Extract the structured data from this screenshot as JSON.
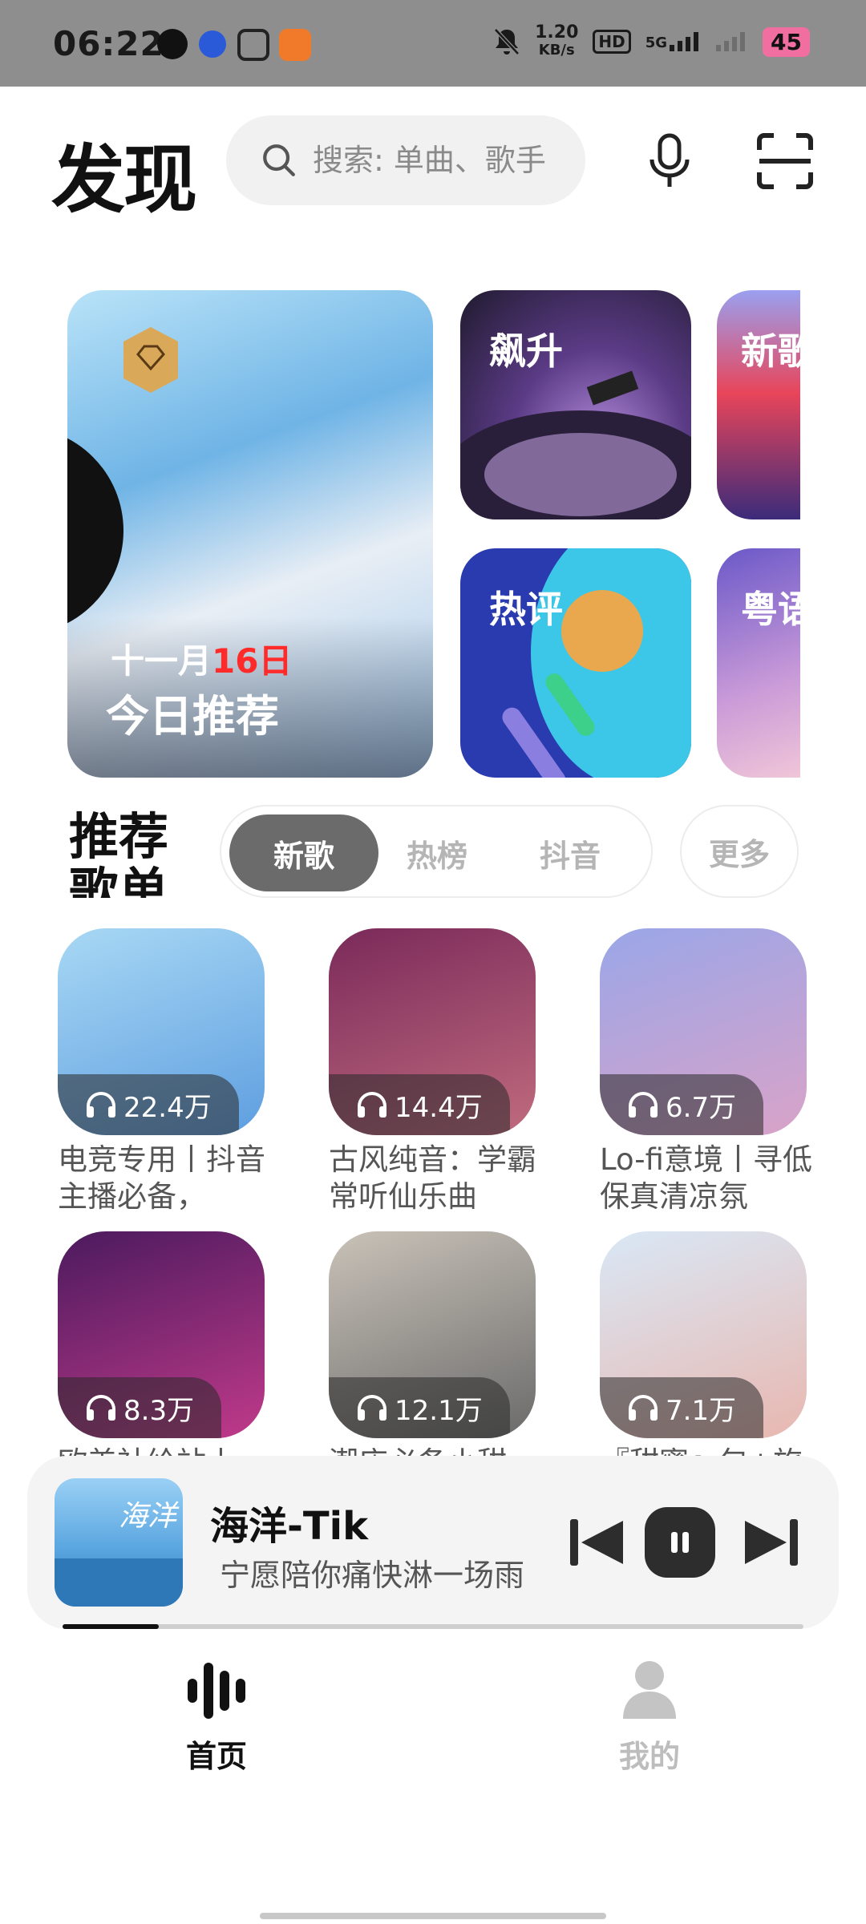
{
  "status_bar": {
    "time": "06:22",
    "net_speed_value": "1.20",
    "net_speed_unit": "KB/s",
    "hd_label": "HD",
    "network": "5G",
    "battery": "45"
  },
  "header": {
    "title": "发现",
    "search_placeholder": "搜索: 单曲、歌手"
  },
  "banners": {
    "daily": {
      "date_prefix": "十一月",
      "date_day": "16日",
      "title": "今日推荐"
    },
    "surge": "飙升",
    "hot_comments": "热评",
    "new_songs": "新歌",
    "cantonese": "粤语"
  },
  "section": {
    "title": "推荐歌单",
    "tabs": [
      "新歌",
      "热榜",
      "抖音"
    ],
    "more": "更多"
  },
  "playlists": [
    {
      "count": "22.4万",
      "title": "电竞专用丨抖音主播必备，",
      "cover": [
        "#a8d8f4",
        "#5e9ee0"
      ]
    },
    {
      "count": "14.4万",
      "title": "古风纯音：学霸常听仙乐曲",
      "cover": [
        "#7a2a5a",
        "#c06b7e"
      ]
    },
    {
      "count": "6.7万",
      "title": "Lo-fi意境丨寻低保真清凉氛",
      "cover": [
        "#9aa6e8",
        "#d9a3c8"
      ]
    },
    {
      "count": "8.3万",
      "title": "欧美社给站丨",
      "cover": [
        "#4b1a5e",
        "#c03a8a"
      ]
    },
    {
      "count": "12.1万",
      "title": "潮店必备小甜",
      "cover": [
        "#c9c2b8",
        "#6a6a6a"
      ]
    },
    {
      "count": "7.1万",
      "title": "『甜蜜』包+旅",
      "cover": [
        "#d9e8f6",
        "#e8b7b0"
      ]
    }
  ],
  "player": {
    "title": "海洋-Tik",
    "subtitle": "宁愿陪你痛快淋一场雨",
    "art_text": "海洋",
    "progress": 0.13
  },
  "nav": {
    "home": "首页",
    "mine": "我的"
  }
}
